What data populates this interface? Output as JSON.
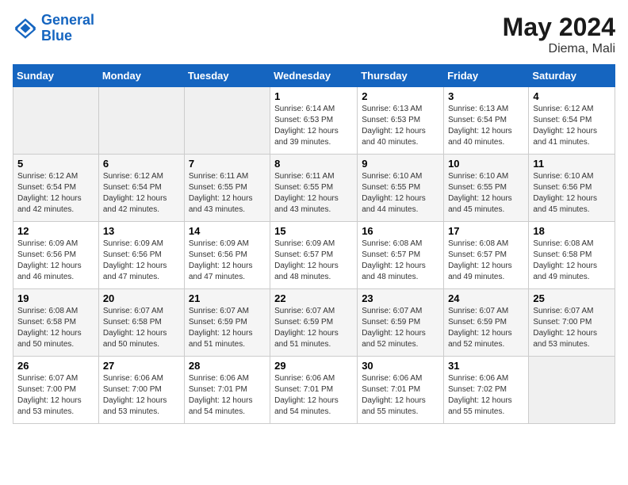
{
  "header": {
    "logo_line1": "General",
    "logo_line2": "Blue",
    "month": "May 2024",
    "location": "Diema, Mali"
  },
  "weekdays": [
    "Sunday",
    "Monday",
    "Tuesday",
    "Wednesday",
    "Thursday",
    "Friday",
    "Saturday"
  ],
  "weeks": [
    [
      {
        "day": "",
        "info": ""
      },
      {
        "day": "",
        "info": ""
      },
      {
        "day": "",
        "info": ""
      },
      {
        "day": "1",
        "info": "Sunrise: 6:14 AM\nSunset: 6:53 PM\nDaylight: 12 hours and 39 minutes."
      },
      {
        "day": "2",
        "info": "Sunrise: 6:13 AM\nSunset: 6:53 PM\nDaylight: 12 hours and 40 minutes."
      },
      {
        "day": "3",
        "info": "Sunrise: 6:13 AM\nSunset: 6:54 PM\nDaylight: 12 hours and 40 minutes."
      },
      {
        "day": "4",
        "info": "Sunrise: 6:12 AM\nSunset: 6:54 PM\nDaylight: 12 hours and 41 minutes."
      }
    ],
    [
      {
        "day": "5",
        "info": "Sunrise: 6:12 AM\nSunset: 6:54 PM\nDaylight: 12 hours and 42 minutes."
      },
      {
        "day": "6",
        "info": "Sunrise: 6:12 AM\nSunset: 6:54 PM\nDaylight: 12 hours and 42 minutes."
      },
      {
        "day": "7",
        "info": "Sunrise: 6:11 AM\nSunset: 6:55 PM\nDaylight: 12 hours and 43 minutes."
      },
      {
        "day": "8",
        "info": "Sunrise: 6:11 AM\nSunset: 6:55 PM\nDaylight: 12 hours and 43 minutes."
      },
      {
        "day": "9",
        "info": "Sunrise: 6:10 AM\nSunset: 6:55 PM\nDaylight: 12 hours and 44 minutes."
      },
      {
        "day": "10",
        "info": "Sunrise: 6:10 AM\nSunset: 6:55 PM\nDaylight: 12 hours and 45 minutes."
      },
      {
        "day": "11",
        "info": "Sunrise: 6:10 AM\nSunset: 6:56 PM\nDaylight: 12 hours and 45 minutes."
      }
    ],
    [
      {
        "day": "12",
        "info": "Sunrise: 6:09 AM\nSunset: 6:56 PM\nDaylight: 12 hours and 46 minutes."
      },
      {
        "day": "13",
        "info": "Sunrise: 6:09 AM\nSunset: 6:56 PM\nDaylight: 12 hours and 47 minutes."
      },
      {
        "day": "14",
        "info": "Sunrise: 6:09 AM\nSunset: 6:56 PM\nDaylight: 12 hours and 47 minutes."
      },
      {
        "day": "15",
        "info": "Sunrise: 6:09 AM\nSunset: 6:57 PM\nDaylight: 12 hours and 48 minutes."
      },
      {
        "day": "16",
        "info": "Sunrise: 6:08 AM\nSunset: 6:57 PM\nDaylight: 12 hours and 48 minutes."
      },
      {
        "day": "17",
        "info": "Sunrise: 6:08 AM\nSunset: 6:57 PM\nDaylight: 12 hours and 49 minutes."
      },
      {
        "day": "18",
        "info": "Sunrise: 6:08 AM\nSunset: 6:58 PM\nDaylight: 12 hours and 49 minutes."
      }
    ],
    [
      {
        "day": "19",
        "info": "Sunrise: 6:08 AM\nSunset: 6:58 PM\nDaylight: 12 hours and 50 minutes."
      },
      {
        "day": "20",
        "info": "Sunrise: 6:07 AM\nSunset: 6:58 PM\nDaylight: 12 hours and 50 minutes."
      },
      {
        "day": "21",
        "info": "Sunrise: 6:07 AM\nSunset: 6:59 PM\nDaylight: 12 hours and 51 minutes."
      },
      {
        "day": "22",
        "info": "Sunrise: 6:07 AM\nSunset: 6:59 PM\nDaylight: 12 hours and 51 minutes."
      },
      {
        "day": "23",
        "info": "Sunrise: 6:07 AM\nSunset: 6:59 PM\nDaylight: 12 hours and 52 minutes."
      },
      {
        "day": "24",
        "info": "Sunrise: 6:07 AM\nSunset: 6:59 PM\nDaylight: 12 hours and 52 minutes."
      },
      {
        "day": "25",
        "info": "Sunrise: 6:07 AM\nSunset: 7:00 PM\nDaylight: 12 hours and 53 minutes."
      }
    ],
    [
      {
        "day": "26",
        "info": "Sunrise: 6:07 AM\nSunset: 7:00 PM\nDaylight: 12 hours and 53 minutes."
      },
      {
        "day": "27",
        "info": "Sunrise: 6:06 AM\nSunset: 7:00 PM\nDaylight: 12 hours and 53 minutes."
      },
      {
        "day": "28",
        "info": "Sunrise: 6:06 AM\nSunset: 7:01 PM\nDaylight: 12 hours and 54 minutes."
      },
      {
        "day": "29",
        "info": "Sunrise: 6:06 AM\nSunset: 7:01 PM\nDaylight: 12 hours and 54 minutes."
      },
      {
        "day": "30",
        "info": "Sunrise: 6:06 AM\nSunset: 7:01 PM\nDaylight: 12 hours and 55 minutes."
      },
      {
        "day": "31",
        "info": "Sunrise: 6:06 AM\nSunset: 7:02 PM\nDaylight: 12 hours and 55 minutes."
      },
      {
        "day": "",
        "info": ""
      }
    ]
  ]
}
